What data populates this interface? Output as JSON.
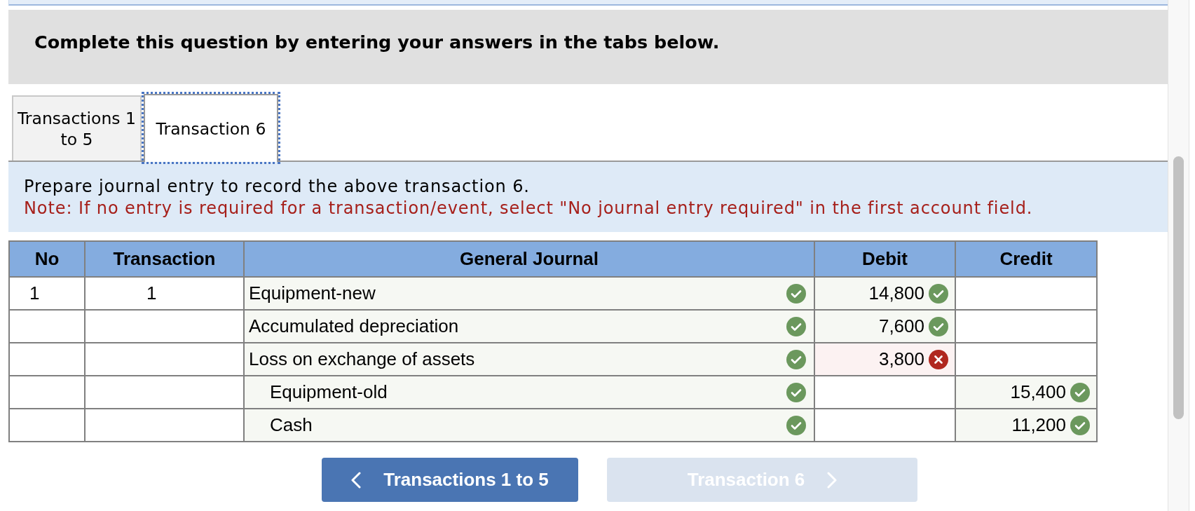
{
  "banner": {
    "text": "Complete this question by entering your answers in the tabs below."
  },
  "tabs": [
    {
      "label": "Transactions 1 to 5",
      "selected": false
    },
    {
      "label": "Transaction 6",
      "selected": true
    }
  ],
  "prompt": {
    "text": "Prepare journal entry to record the above transaction 6.",
    "note": "Note: If no entry is required for a transaction/event, select \"No journal entry required\" in the first account field."
  },
  "journal": {
    "columns": [
      "No",
      "Transaction",
      "General Journal",
      "Debit",
      "Credit"
    ],
    "rows": [
      {
        "no": "1",
        "transaction": "1",
        "account": "Equipment-new",
        "indented": false,
        "account_correct": true,
        "debit": {
          "value": "14,800",
          "correct": true
        }
      },
      {
        "account": "Accumulated depreciation",
        "indented": false,
        "account_correct": true,
        "debit": {
          "value": "7,600",
          "correct": true
        }
      },
      {
        "account": "Loss on exchange of assets",
        "indented": false,
        "account_correct": true,
        "debit": {
          "value": "3,800",
          "correct": false
        }
      },
      {
        "account": "Equipment-old",
        "indented": true,
        "account_correct": true,
        "credit": {
          "value": "15,400",
          "correct": true
        }
      },
      {
        "account": "Cash",
        "indented": true,
        "account_correct": true,
        "credit": {
          "value": "11,200",
          "correct": true
        }
      }
    ]
  },
  "nav_buttons": [
    {
      "label": "Transactions 1 to 5",
      "kind": "prev",
      "disabled": false
    },
    {
      "label": "Transaction 6",
      "kind": "next",
      "disabled": true
    }
  ]
}
